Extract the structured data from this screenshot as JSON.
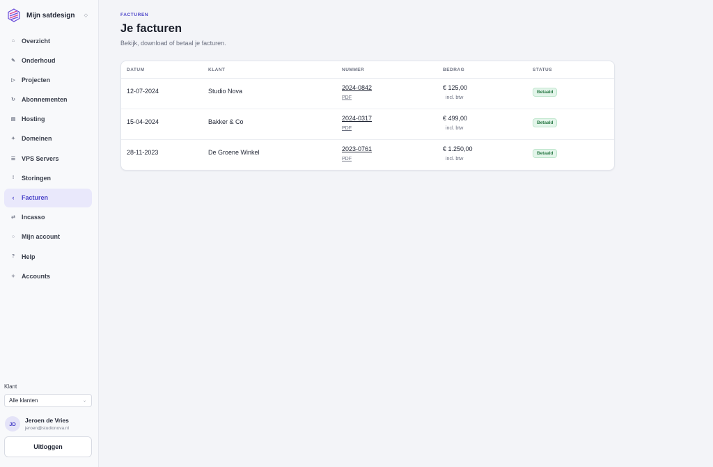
{
  "sidebar": {
    "brand": "Mijn satdesign",
    "items": [
      {
        "label": "Overzicht",
        "icon": "home-icon",
        "glyph": "⌂"
      },
      {
        "label": "Onderhoud",
        "icon": "wrench-icon",
        "glyph": "✎"
      },
      {
        "label": "Projecten",
        "icon": "play-icon",
        "glyph": "▷"
      },
      {
        "label": "Abonnementen",
        "icon": "refresh-icon",
        "glyph": "↻"
      },
      {
        "label": "Hosting",
        "icon": "server-icon",
        "glyph": "▤"
      },
      {
        "label": "Domeinen",
        "icon": "globe-icon",
        "glyph": "✦"
      },
      {
        "label": "VPS Servers",
        "icon": "list-icon",
        "glyph": "☰"
      },
      {
        "label": "Storingen",
        "icon": "alert-icon",
        "glyph": "!"
      },
      {
        "label": "Facturen",
        "icon": "chevron-left-icon",
        "glyph": "‹"
      },
      {
        "label": "Incasso",
        "icon": "transfer-icon",
        "glyph": "⇄"
      },
      {
        "label": "Mijn account",
        "icon": "user-icon",
        "glyph": "○"
      },
      {
        "label": "Help",
        "icon": "help-icon",
        "glyph": "?"
      },
      {
        "label": "Accounts",
        "icon": "accounts-icon",
        "glyph": "✧"
      }
    ],
    "active_index": 8,
    "klant_label": "Klant",
    "klant_value": "Alle klanten",
    "user_initials": "JD",
    "user_name": "Jeroen de Vries",
    "user_email": "jeroen@studionova.nl",
    "logout_label": "Uitloggen"
  },
  "main": {
    "eyebrow": "FACTUREN",
    "title": "Je facturen",
    "subtitle": "Bekijk, download of betaal je facturen."
  },
  "table": {
    "headers": [
      "DATUM",
      "KLANT",
      "NUMMER",
      "BEDRAG",
      "STATUS"
    ],
    "rows": [
      {
        "date": "12-07-2024",
        "klant": "Studio Nova",
        "number": "2024-0842",
        "pdf": "PDF",
        "amount": "€ 125,00",
        "btw": "incl. btw",
        "status": "Betaald"
      },
      {
        "date": "15-04-2024",
        "klant": "Bakker & Co",
        "number": "2024-0317",
        "pdf": "PDF",
        "amount": "€ 499,00",
        "btw": "incl. btw",
        "status": "Betaald"
      },
      {
        "date": "28-11-2023",
        "klant": "De Groene Winkel",
        "number": "2023-0761",
        "pdf": "PDF",
        "amount": "€ 1.250,00",
        "btw": "incl. btw",
        "status": "Betaald"
      }
    ]
  },
  "colors": {
    "accent": "#4b44c9",
    "status_paid_bg": "#e3f5ea",
    "status_paid_text": "#2b7a47"
  }
}
